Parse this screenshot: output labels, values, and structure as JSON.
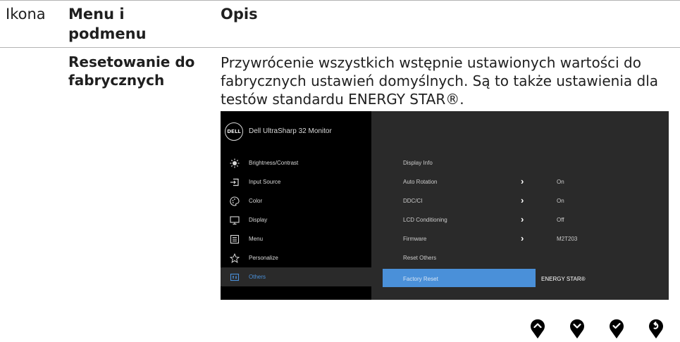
{
  "table": {
    "col_icon": "Ikona",
    "col_menu": "Menu i podmenu",
    "col_desc": "Opis"
  },
  "entry": {
    "submenu": "Resetowanie do fabrycznych",
    "description": "Przywrócenie wszystkich wstępnie ustawionych wartości do fabrycznych ustawień domyślnych. Są to także ustawienia dla testów standardu ENERGY STAR®."
  },
  "osd": {
    "logo": "DELL",
    "monitor_name": "Dell UltraSharp 32 Monitor",
    "menu_items": [
      {
        "label": "Brightness/Contrast",
        "icon": "brightness-icon"
      },
      {
        "label": "Input Source",
        "icon": "input-source-icon"
      },
      {
        "label": "Color",
        "icon": "color-icon"
      },
      {
        "label": "Display",
        "icon": "display-icon"
      },
      {
        "label": "Menu",
        "icon": "menu-icon"
      },
      {
        "label": "Personalize",
        "icon": "star-icon"
      },
      {
        "label": "Others",
        "icon": "others-icon"
      }
    ],
    "active_menu": "Others",
    "settings": [
      {
        "label": "Display Info",
        "value": ""
      },
      {
        "label": "Auto Rotation",
        "value": "On"
      },
      {
        "label": "DDC/CI",
        "value": "On"
      },
      {
        "label": "LCD Conditioning",
        "value": "Off"
      },
      {
        "label": "Firmware",
        "value": "M2T203"
      },
      {
        "label": "Reset Others",
        "value": ""
      },
      {
        "label": "Factory Reset",
        "value": "ENERGY STAR®"
      }
    ]
  },
  "nav_buttons": [
    "up-icon",
    "down-icon",
    "check-icon",
    "back-icon"
  ],
  "colors": {
    "highlight": "#4a90d9",
    "osd_dark": "#000000",
    "osd_panel": "#2a2a2a"
  }
}
